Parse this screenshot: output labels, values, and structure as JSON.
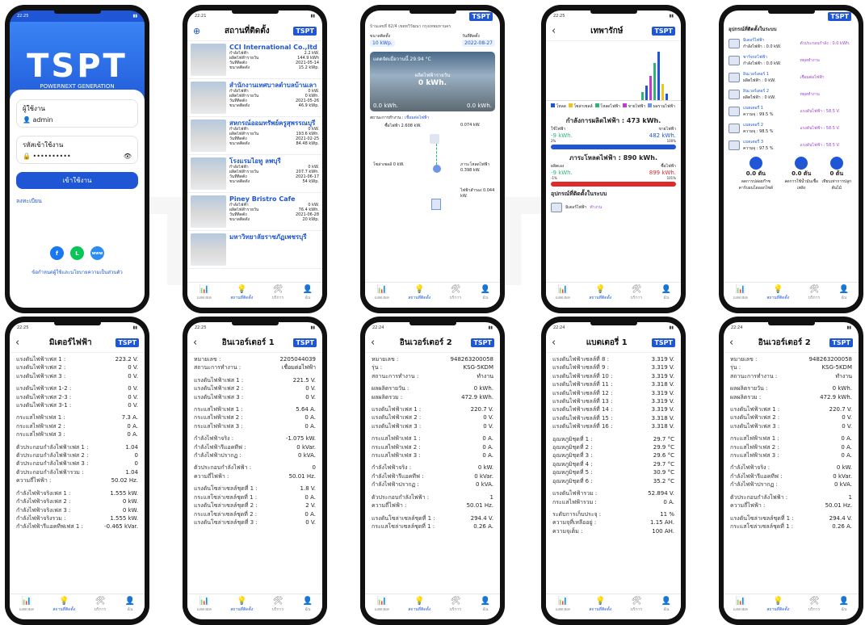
{
  "brand": {
    "logo": "TSPT",
    "subtitle": "POWERNEXT GENERATION"
  },
  "nav": [
    "แสดงผล",
    "สถานที่ติดตั้ง",
    "บริการ",
    "ฉัน"
  ],
  "times": [
    "22:25",
    "22:21",
    "22:25",
    "22:24"
  ],
  "login": {
    "user_label": "ผู้ใช้งาน",
    "user_value": "admin",
    "pass_label": "รหัสเข้าใช้งาน",
    "pass_value": "••••••••••",
    "login_btn": "เข้าใช้งาน",
    "register": "ลงทะเบียน",
    "www": "www",
    "policy": "ข้อกำหนดผู้ใช้และนโยบายความเป็นส่วนตัว"
  },
  "sites": {
    "title": "สถานที่ติดตั้ง",
    "items": [
      {
        "name": "CCI International Co.,ltd",
        "power": "2.2 kW.",
        "energy": "144.9 kWh",
        "date": "2021-05-14",
        "size": "15.2 kWp."
      },
      {
        "name": "สำนักงานเทศบาลตำบลบ้านเลา",
        "power": "0 kW.",
        "energy": "0 kWh.",
        "date": "2021-05-26",
        "size": "46.9 kWp."
      },
      {
        "name": "สหกรณ์ออมทรัพย์ครูสุพรรณบุรี",
        "power": "0 kW.",
        "energy": "193.6 kWh.",
        "date": "2021-02-25",
        "size": "84.48 kWp."
      },
      {
        "name": "โรงแรมไอทู ลพบุรี",
        "power": "0 kW.",
        "energy": "207.7 kWh.",
        "date": "2021-06-17",
        "size": "54 kWp."
      },
      {
        "name": "Piney Bristro Cafe",
        "power": "0 kW.",
        "energy": "76.4 kWh.",
        "date": "2021-06-28",
        "size": "20 kWp."
      },
      {
        "name": "มหาวิทยาลัยราชภัฏเพชรบุรี",
        "power": "",
        "energy": "",
        "date": "",
        "size": ""
      }
    ],
    "labels": {
      "power": "กำลังไฟฟ้า",
      "energy": "ผลิตไฟฟ้ารายวัน",
      "date": "วันที่ติดตั้ง",
      "size": "ขนาดติดตั้ง"
    }
  },
  "detail": {
    "address": "บ้านเลขที่ 62/4 เขตทวีวัฒนา กรุงเทพมหานคร",
    "size_label": "ขนาดติดตั้ง",
    "size": "10 kWp.",
    "date_label": "วันที่ติดตั้ง",
    "date": "2022-08-27",
    "weather": "แดดจัดเมื่อวานนี้ 29.94 °C",
    "daily_label": "ผลิตไฟฟ้ารายวัน",
    "daily": "0 kWh.",
    "left_kwh": "0.0 kWh.",
    "right_kwh": "0.0 kWh.",
    "status_label": "สถานะการทำงาน :",
    "status": "เชื่อมต่อไฟฟ้า",
    "buy": "ซื้อไฟฟ้า 2.608 kW.",
    "sell": "0.074 kW.",
    "solar": "โซล่าเซลล์ 0 kW.",
    "load": "ภาระโหลดไฟฟ้า 0.398 kW.",
    "backup": "ไฟฟ้าสำรอง 0.044 kW."
  },
  "pattern": {
    "title": "เทพารักษ์",
    "legend": [
      "โหลด",
      "โซล่าเซลล์",
      "โหลดไฟฟ้า",
      "ขายไฟฟ้า",
      "ผลรวมไฟฟ้า"
    ],
    "prod_title": "กำลังการผลิตไฟฟ้า : 473 kWh.",
    "use_label": "ใช้ไฟฟ้า",
    "sell_label": "ขายไฟฟ้า",
    "use_val": "-9 kWh.",
    "sell_val": "482 kWh.",
    "p1": "2%",
    "p2": "100%",
    "load_title": "ภาระโหลดไฟฟ้า : 890 kWh.",
    "self_label": "ผลิตเอง",
    "buy_label": "ซื้อไฟฟ้า",
    "self_val": "-9 kWh.",
    "buy_val": "899 kWh.",
    "q1": "-1%",
    "q2": "101%",
    "dev_title": "อุปกรณ์ที่ติดตั้งในระบบ",
    "meter": "มิเตอร์ไฟฟ้า",
    "working": "ทำงาน"
  },
  "devices": {
    "title": "อุปกรณ์ที่ติดตั้งในระบบ",
    "items": [
      {
        "name": "มิเตอร์ไฟฟ้า",
        "a": "กำลังไฟฟ้า : 0.0 kW.",
        "b": "ตัวประกอบกำลัง : 0.0 kWh."
      },
      {
        "name": "ชาร์จรถไฟฟ้า",
        "a": "กำลังไฟฟ้า : 0.0 kW.",
        "b": "หยุดทำงาน"
      },
      {
        "name": "อินเวอร์เตอร์ 1",
        "a": "ผลิตไฟฟ้า : 0 kW.",
        "b": "เชื่อมต่อไฟฟ้า"
      },
      {
        "name": "อินเวอร์เตอร์ 2",
        "a": "ผลิตไฟฟ้า : 0 kW.",
        "b": "หยุดทำงาน"
      },
      {
        "name": "แบตเตอรี่ 1",
        "a": "ความจุ : 99.5 %",
        "b": "แรงดันไฟฟ้า : 58.5 V."
      },
      {
        "name": "แบตเตอรี่ 2",
        "a": "ความจุ : 98.5 %",
        "b": "แรงดันไฟฟ้า : 58.5 V."
      },
      {
        "name": "แบตเตอรี่ 3",
        "a": "ความจุ : 97.5 %",
        "b": "แรงดันไฟฟ้า : 58.5 V."
      }
    ],
    "stats": [
      "0.0 ตัน",
      "0.0 ตัน",
      "0 ต้น"
    ],
    "stat_labels": [
      "ลดการปล่อยก๊าซคาร์บอนไดออกไซด์",
      "ลดการใช้น้ำมันเชื้อเพลิง",
      "เทียบเท่าการปลูกต้นไม้"
    ]
  },
  "meter": {
    "title": "มิเตอร์ไฟฟ้า",
    "rows": [
      [
        "แรงดันไฟฟ้าเฟส 1 :",
        "223.2 V."
      ],
      [
        "แรงดันไฟฟ้าเฟส 2 :",
        "0 V."
      ],
      [
        "แรงดันไฟฟ้าเฟส 3 :",
        "0 V."
      ],
      [
        "",
        ""
      ],
      [
        "แรงดันไฟฟ้าเฟส 1-2 :",
        "0 V."
      ],
      [
        "แรงดันไฟฟ้าเฟส 2-3 :",
        "0 V."
      ],
      [
        "แรงดันไฟฟ้าเฟส 3-1 :",
        "0 V."
      ],
      [
        "",
        ""
      ],
      [
        "กระแสไฟฟ้าเฟส 1 :",
        "7.3 A."
      ],
      [
        "กระแสไฟฟ้าเฟส 2 :",
        "0 A."
      ],
      [
        "กระแสไฟฟ้าเฟส 3 :",
        "0 A."
      ],
      [
        "",
        ""
      ],
      [
        "ตัวประกอบกำลังไฟฟ้าเฟส 1 :",
        "1.04"
      ],
      [
        "ตัวประกอบกำลังไฟฟ้าเฟส 2 :",
        "0"
      ],
      [
        "ตัวประกอบกำลังไฟฟ้าเฟส 3 :",
        "0"
      ],
      [
        "ตัวประกอบกำลังไฟฟ้ารวม :",
        "1.04"
      ],
      [
        "ความถี่ไฟฟ้า :",
        "50.02 Hz."
      ],
      [
        "",
        ""
      ],
      [
        "กำลังไฟฟ้าจริงเฟส 1 :",
        "1.555 kW."
      ],
      [
        "กำลังไฟฟ้าจริงเฟส 2 :",
        "0 kW."
      ],
      [
        "กำลังไฟฟ้าจริงเฟส 3 :",
        "0 kW."
      ],
      [
        "กำลังไฟฟ้าจริงรวม :",
        "1.555 kW."
      ],
      [
        "กำลังไฟฟ้ารีแอคทีฟเฟส 1 :",
        "-0.465 kVar."
      ]
    ]
  },
  "inv1": {
    "title": "อินเวอร์เตอร์ 1",
    "rows": [
      [
        "หมายเลข :",
        "2205044039"
      ],
      [
        "สถานะการทำงาน :",
        "เชื่อมต่อไฟฟ้า"
      ],
      [
        "",
        ""
      ],
      [
        "แรงดันไฟฟ้าเฟส 1 :",
        "221.5 V."
      ],
      [
        "แรงดันไฟฟ้าเฟส 2 :",
        "0 V."
      ],
      [
        "แรงดันไฟฟ้าเฟส 3 :",
        "0 V."
      ],
      [
        "",
        ""
      ],
      [
        "กระแสไฟฟ้าเฟส 1 :",
        "5.64 A."
      ],
      [
        "กระแสไฟฟ้าเฟส 2 :",
        "0 A."
      ],
      [
        "กระแสไฟฟ้าเฟส 3 :",
        "0 A."
      ],
      [
        "",
        ""
      ],
      [
        "กำลังไฟฟ้าจริง :",
        "-1.075 kW."
      ],
      [
        "กำลังไฟฟ้ารีแอคทีฟ :",
        "0 kVar."
      ],
      [
        "กำลังไฟฟ้าปรากฏ :",
        "0 kVA."
      ],
      [
        "",
        ""
      ],
      [
        "ตัวประกอบกำลังไฟฟ้า :",
        "0"
      ],
      [
        "ความถี่ไฟฟ้า :",
        "50.01 Hz."
      ],
      [
        "",
        ""
      ],
      [
        "แรงดันโซล่าเซลล์ชุดที่ 1 :",
        "1.8 V."
      ],
      [
        "กระแสโซล่าเซลล์ชุดที่ 1 :",
        "0 A."
      ],
      [
        "แรงดันโซล่าเซลล์ชุดที่ 2 :",
        "2 V."
      ],
      [
        "กระแสโซล่าเซลล์ชุดที่ 2 :",
        "0 A."
      ],
      [
        "แรงดันโซล่าเซลล์ชุดที่ 3 :",
        "0 V."
      ]
    ]
  },
  "inv2": {
    "title": "อินเวอร์เตอร์ 2",
    "rows": [
      [
        "หมายเลข :",
        "948263200058"
      ],
      [
        "รุ่น :",
        "KSG-5KDM"
      ],
      [
        "สถานะการทำงาน :",
        "ทำงาน"
      ],
      [
        "",
        ""
      ],
      [
        "ผลผลิตรายวัน :",
        "0 kWh."
      ],
      [
        "ผลผลิตรวม :",
        "472.9 kWh."
      ],
      [
        "",
        ""
      ],
      [
        "แรงดันไฟฟ้าเฟส 1 :",
        "220.7 V."
      ],
      [
        "แรงดันไฟฟ้าเฟส 2 :",
        "0 V."
      ],
      [
        "แรงดันไฟฟ้าเฟส 3 :",
        "0 V."
      ],
      [
        "",
        ""
      ],
      [
        "กระแสไฟฟ้าเฟส 1 :",
        "0 A."
      ],
      [
        "กระแสไฟฟ้าเฟส 2 :",
        "0 A."
      ],
      [
        "กระแสไฟฟ้าเฟส 3 :",
        "0 A."
      ],
      [
        "",
        ""
      ],
      [
        "กำลังไฟฟ้าจริง :",
        "0 kW."
      ],
      [
        "กำลังไฟฟ้ารีแอคทีฟ :",
        "0 kVar."
      ],
      [
        "กำลังไฟฟ้าปรากฏ :",
        "0 kVA."
      ],
      [
        "",
        ""
      ],
      [
        "ตัวประกอบกำลังไฟฟ้า :",
        "1"
      ],
      [
        "ความถี่ไฟฟ้า :",
        "50.01 Hz."
      ],
      [
        "",
        ""
      ],
      [
        "แรงดันโซล่าเซลล์ชุดที่ 1 :",
        "294.4 V."
      ],
      [
        "กระแสโซล่าเซลล์ชุดที่ 1 :",
        "0.26 A."
      ]
    ]
  },
  "bat1": {
    "title": "แบตเตอรี่ 1",
    "rows": [
      [
        "แรงดันไฟฟ้าเซลล์ที่ 8 :",
        "3.319 V."
      ],
      [
        "แรงดันไฟฟ้าเซลล์ที่ 9 :",
        "3.319 V."
      ],
      [
        "แรงดันไฟฟ้าเซลล์ที่ 10 :",
        "3.319 V."
      ],
      [
        "แรงดันไฟฟ้าเซลล์ที่ 11 :",
        "3.318 V."
      ],
      [
        "แรงดันไฟฟ้าเซลล์ที่ 12 :",
        "3.319 V."
      ],
      [
        "แรงดันไฟฟ้าเซลล์ที่ 13 :",
        "3.319 V."
      ],
      [
        "แรงดันไฟฟ้าเซลล์ที่ 14 :",
        "3.319 V."
      ],
      [
        "แรงดันไฟฟ้าเซลล์ที่ 15 :",
        "3.318 V."
      ],
      [
        "แรงดันไฟฟ้าเซลล์ที่ 16 :",
        "3.318 V."
      ],
      [
        "",
        ""
      ],
      [
        "อุณหภูมิชุดที่ 1 :",
        "29.7 °C"
      ],
      [
        "อุณหภูมิชุดที่ 2 :",
        "29.9 °C"
      ],
      [
        "อุณหภูมิชุดที่ 3 :",
        "29.6 °C"
      ],
      [
        "อุณหภูมิชุดที่ 4 :",
        "29.7 °C"
      ],
      [
        "อุณหภูมิชุดที่ 5 :",
        "30.9 °C"
      ],
      [
        "อุณหภูมิชุดที่ 6 :",
        "35.2 °C"
      ],
      [
        "",
        ""
      ],
      [
        "แรงดันไฟฟ้ารวม :",
        "52.894 V."
      ],
      [
        "กระแสไฟฟ้ารวม :",
        "0 A."
      ],
      [
        "",
        ""
      ],
      [
        "ระดับการเก็บประจุ :",
        "11 %"
      ],
      [
        "ความจุที่เหลืออยู่ :",
        "1.15 AH."
      ],
      [
        "ความจุเต็ม :",
        "100 AH."
      ]
    ]
  },
  "inv2b": {
    "title": "อินเวอร์เตอร์ 2",
    "rows": [
      [
        "หมายเลข :",
        "948263200058"
      ],
      [
        "รุ่น :",
        "KSG-5KDM"
      ],
      [
        "สถานะการทำงาน :",
        "ทำงาน"
      ],
      [
        "",
        ""
      ],
      [
        "ผลผลิตรายวัน :",
        "0 kWh."
      ],
      [
        "ผลผลิตรวม :",
        "472.9 kWh."
      ],
      [
        "",
        ""
      ],
      [
        "แรงดันไฟฟ้าเฟส 1 :",
        "220.7 V."
      ],
      [
        "แรงดันไฟฟ้าเฟส 2 :",
        "0 V."
      ],
      [
        "แรงดันไฟฟ้าเฟส 3 :",
        "0 V."
      ],
      [
        "",
        ""
      ],
      [
        "กระแสไฟฟ้าเฟส 1 :",
        "0 A."
      ],
      [
        "กระแสไฟฟ้าเฟส 2 :",
        "0 A."
      ],
      [
        "กระแสไฟฟ้าเฟส 3 :",
        "0 A."
      ],
      [
        "",
        ""
      ],
      [
        "กำลังไฟฟ้าจริง :",
        "0 kW."
      ],
      [
        "กำลังไฟฟ้ารีแอคทีฟ :",
        "0 kVar."
      ],
      [
        "กำลังไฟฟ้าปรากฏ :",
        "0 kVA."
      ],
      [
        "",
        ""
      ],
      [
        "ตัวประกอบกำลังไฟฟ้า :",
        "1"
      ],
      [
        "ความถี่ไฟฟ้า :",
        "50.01 Hz."
      ],
      [
        "",
        ""
      ],
      [
        "แรงดันโซล่าเซลล์ชุดที่ 1 :",
        "294.4 V."
      ],
      [
        "กระแสโซล่าเซลล์ชุดที่ 1 :",
        "0.26 A."
      ]
    ]
  }
}
